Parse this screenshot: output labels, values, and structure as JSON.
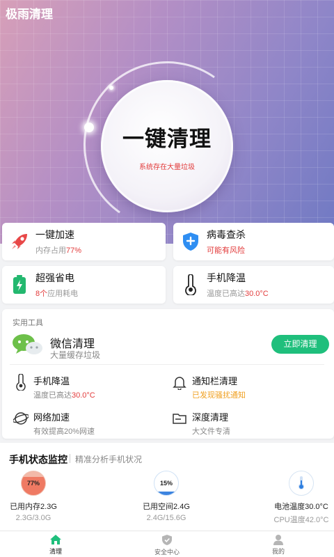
{
  "app": {
    "title": "极雨清理"
  },
  "hero": {
    "button_title": "一键清理",
    "button_sub": "系统存在大量垃圾"
  },
  "quick": [
    {
      "title": "一键加速",
      "sub_prefix": "内存占用",
      "sub_highlight": "77%",
      "sub_suffix": ""
    },
    {
      "title": "病毒查杀",
      "sub_prefix": "",
      "sub_highlight": "可能有风险",
      "sub_suffix": ""
    },
    {
      "title": "超强省电",
      "sub_prefix": "",
      "sub_highlight": "8个",
      "sub_suffix": "应用耗电"
    },
    {
      "title": "手机降温",
      "sub_prefix": "温度已高达",
      "sub_highlight": "30.0°C",
      "sub_suffix": ""
    }
  ],
  "tools": {
    "label": "实用工具",
    "wechat": {
      "title": "微信清理",
      "sub": "大量缓存垃圾",
      "button": "立即清理"
    },
    "items": [
      {
        "title": "手机降温",
        "sub_prefix": "温度已高达",
        "sub_highlight": "30.0°C"
      },
      {
        "title": "通知栏清理",
        "sub_prefix": "",
        "sub_highlight": "已发现骚扰通知"
      },
      {
        "title": "网络加速",
        "sub_prefix": "有效提高20%网速",
        "sub_highlight": ""
      },
      {
        "title": "深度清理",
        "sub_prefix": "大文件专清",
        "sub_highlight": ""
      }
    ]
  },
  "monitor": {
    "title": "手机状态监控",
    "sub": "精准分析手机状况",
    "items": [
      {
        "gauge": "77%",
        "label": "已用内存2.3G",
        "value": "2.3G/3.0G",
        "fill": 0.77
      },
      {
        "gauge": "15%",
        "label": "已用空间2.4G",
        "value": "2.4G/15.6G",
        "fill": 0.15
      },
      {
        "gauge": "",
        "label": "电池温度30.0°C",
        "value": "CPU温度42.0°C",
        "fill": 0.3
      }
    ]
  },
  "tabs": [
    {
      "label": "清理"
    },
    {
      "label": "安全中心"
    },
    {
      "label": "我的"
    }
  ],
  "colors": {
    "accent": "#1fbf7c",
    "warn": "#e23b3b",
    "notice": "#f0a020"
  }
}
